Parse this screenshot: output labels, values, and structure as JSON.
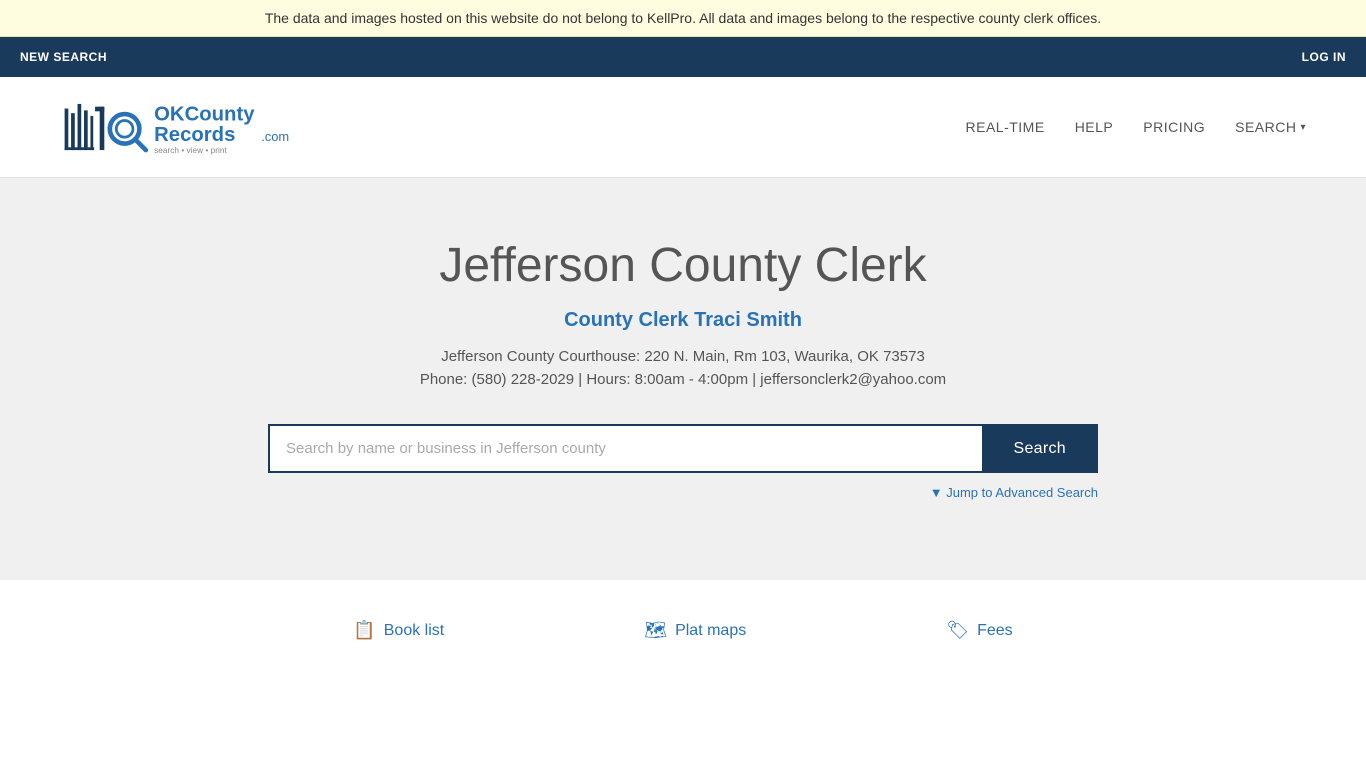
{
  "banner": {
    "text": "The data and images hosted on this website do not belong to KellPro. All data and images belong to the respective county clerk offices."
  },
  "topNav": {
    "newSearch": "NEW SEARCH",
    "login": "LOG IN"
  },
  "header": {
    "logo": {
      "alt": "OKCountyRecords.com"
    },
    "nav": {
      "realtime": "REAL-TIME",
      "help": "HELP",
      "pricing": "PRICING",
      "search": "SEARCH"
    }
  },
  "hero": {
    "title": "Jefferson County Clerk",
    "clerkName": "County Clerk Traci Smith",
    "address": "Jefferson County Courthouse: 220 N. Main, Rm 103, Waurika, OK 73573",
    "contact": "Phone: (580) 228-2029 | Hours: 8:00am - 4:00pm | jeffersonclerk2@yahoo.com",
    "searchPlaceholder": "Search by name or business in Jefferson county",
    "searchButton": "Search",
    "advancedSearch": "▼ Jump to Advanced Search"
  },
  "footerLinks": [
    {
      "label": "Book list",
      "icon": "📋"
    },
    {
      "label": "Plat maps",
      "icon": "🗺"
    },
    {
      "label": "Fees",
      "icon": "🏷"
    }
  ]
}
